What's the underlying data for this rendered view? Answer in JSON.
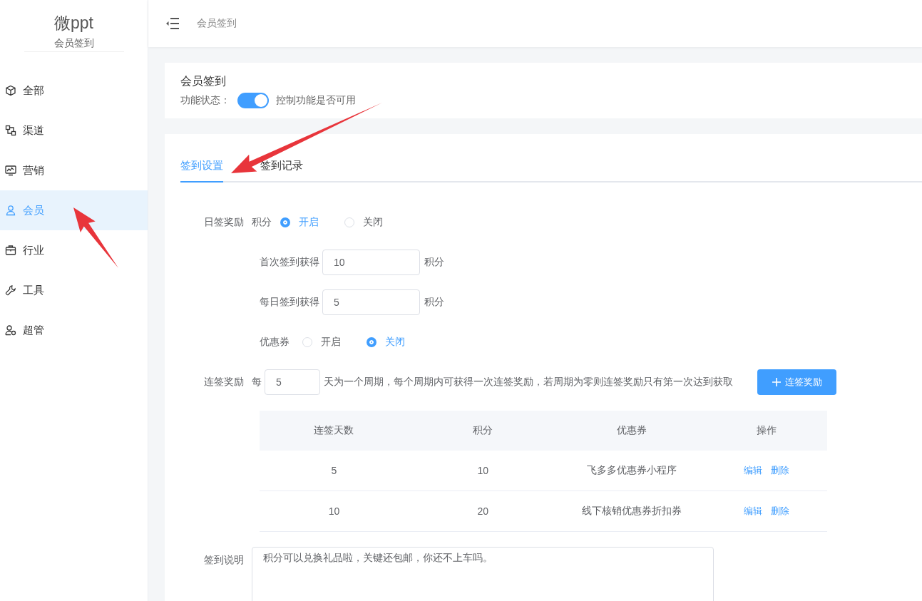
{
  "sidebar": {
    "logo": "微ppt",
    "subtitle": "会员签到",
    "items": [
      {
        "label": "全部",
        "selected": false
      },
      {
        "label": "渠道",
        "selected": false
      },
      {
        "label": "营销",
        "selected": false
      },
      {
        "label": "会员",
        "selected": true
      },
      {
        "label": "行业",
        "selected": false
      },
      {
        "label": "工具",
        "selected": false
      },
      {
        "label": "超管",
        "selected": false
      }
    ]
  },
  "header": {
    "breadcrumb": "会员签到"
  },
  "feature": {
    "title": "会员签到",
    "status_label": "功能状态：",
    "enabled": true,
    "hint": "控制功能是否可用"
  },
  "tabs": [
    {
      "label": "签到设置",
      "selected": true
    },
    {
      "label": "签到记录",
      "selected": false
    }
  ],
  "daily_reward": {
    "label": "日签奖励",
    "points_label": "积分",
    "options": [
      {
        "label": "开启",
        "selected": true
      },
      {
        "label": "关闭",
        "selected": false
      }
    ],
    "first_signin": {
      "label": "首次签到获得",
      "value": "10",
      "unit": "积分"
    },
    "daily_signin": {
      "label": "每日签到获得",
      "value": "5",
      "unit": "积分"
    },
    "coupon": {
      "label": "优惠券",
      "options": [
        {
          "label": "开启",
          "selected": false
        },
        {
          "label": "关闭",
          "selected": true
        }
      ]
    }
  },
  "streak_reward": {
    "label": "连签奖励",
    "prefix": "每",
    "value": "5",
    "description": "天为一个周期，每个周期内可获得一次连签奖励，若周期为零则连签奖励只有第一次达到获取",
    "add_button": "连签奖励"
  },
  "table": {
    "columns": [
      "连签天数",
      "积分",
      "优惠券",
      "操作"
    ],
    "rows": [
      {
        "days": "5",
        "points": "10",
        "coupon": "飞多多优惠券小程序",
        "actions": [
          "编辑",
          "删除"
        ]
      },
      {
        "days": "10",
        "points": "20",
        "coupon": "线下核销优惠券折扣券",
        "actions": [
          "编辑",
          "删除"
        ]
      }
    ]
  },
  "description": {
    "label": "签到说明",
    "value": "积分可以兑换礼品啦，关键还包邮，你还不上车吗。"
  }
}
